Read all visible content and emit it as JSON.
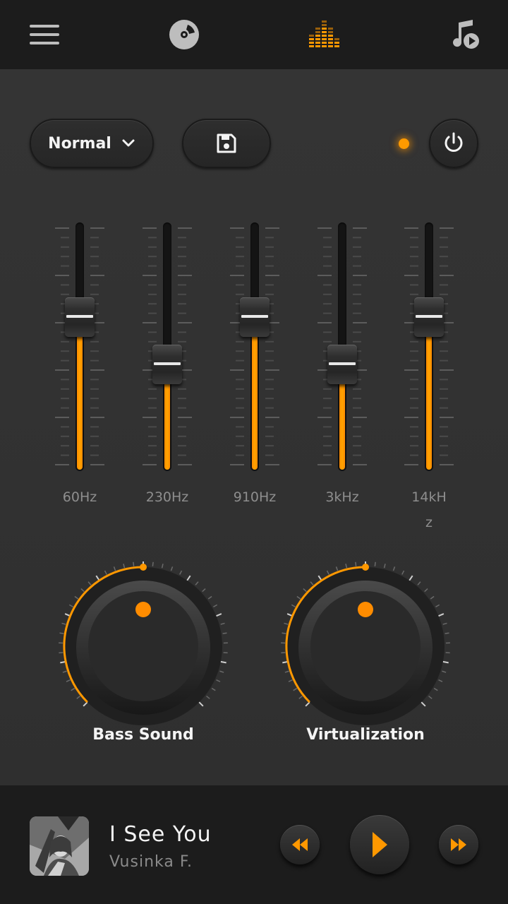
{
  "topbar": {
    "icons": [
      "menu-icon",
      "disc-icon",
      "equalizer-icon",
      "music-note-play-icon"
    ],
    "active_index": 2
  },
  "controls": {
    "preset_label": "Normal",
    "preset_icon": "chevron-down-icon",
    "save_icon": "floppy-disk-icon",
    "power_icon": "power-icon",
    "power_on": true
  },
  "equalizer": {
    "bands": [
      {
        "label": "60Hz",
        "level": 0.62
      },
      {
        "label": "230Hz",
        "level": 0.43
      },
      {
        "label": "910Hz",
        "level": 0.62
      },
      {
        "label": "3kHz",
        "level": 0.43
      },
      {
        "label": "14kHz",
        "level": 0.62
      }
    ]
  },
  "knobs": [
    {
      "label": "Bass Sound",
      "level": 0.5
    },
    {
      "label": "Virtualization",
      "level": 0.5
    }
  ],
  "player": {
    "title": "I See You",
    "artist": "Vusinka F.",
    "rewind_icon": "rewind-icon",
    "play_icon": "play-icon",
    "forward_icon": "fast-forward-icon"
  },
  "colors": {
    "accent": "#ff9800",
    "background": "#323232",
    "bar": "#1c1c1c",
    "label": "#8e8e8e"
  }
}
